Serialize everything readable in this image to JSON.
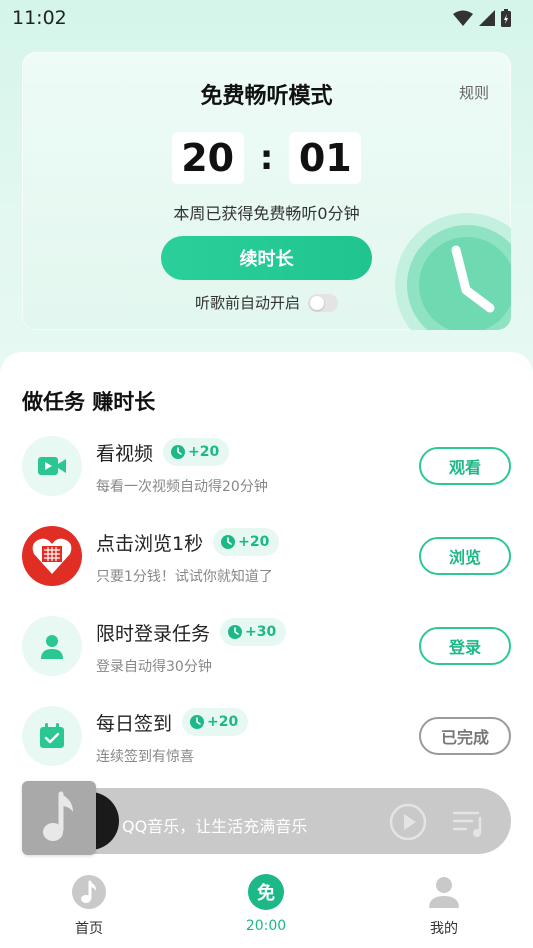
{
  "status_bar": {
    "time": "11:02"
  },
  "hero": {
    "title": "免费畅听模式",
    "rules_label": "规则",
    "timer": {
      "minutes": "20",
      "separator": ":",
      "seconds": "01"
    },
    "subtitle": "本周已获得免费畅听0分钟",
    "extend_button": "续时长",
    "auto_start_label": "听歌前自动开启",
    "auto_start_enabled": false
  },
  "tasks_section": {
    "title": "做任务 赚时长",
    "tasks": [
      {
        "title": "看视频",
        "reward": "+20",
        "desc": "每看一次视频自动得20分钟",
        "button": "观看",
        "icon": "video-icon",
        "done": false
      },
      {
        "title": "点击浏览1秒",
        "reward": "+20",
        "desc": "只要1分钱！试试你就知道了",
        "button": "浏览",
        "icon": "pinduoduo-icon",
        "done": false
      },
      {
        "title": "限时登录任务",
        "reward": "+30",
        "desc": "登录自动得30分钟",
        "button": "登录",
        "icon": "user-icon",
        "done": false
      },
      {
        "title": "每日签到",
        "reward": "+20",
        "desc": "连续签到有惊喜",
        "button": "已完成",
        "icon": "calendar-check-icon",
        "done": true
      }
    ]
  },
  "player": {
    "title": "QQ音乐，让生活充满音乐"
  },
  "bottom_nav": {
    "items": [
      {
        "label": "首页",
        "icon": "music-note-icon"
      },
      {
        "label": "20:00",
        "icon": "free-mode-icon",
        "active": true,
        "icon_text": "免"
      },
      {
        "label": "我的",
        "icon": "profile-icon"
      }
    ]
  },
  "colors": {
    "accent": "#1db888",
    "accent_light": "#e6f8f1",
    "hero_bg": "#e2f7ef"
  }
}
